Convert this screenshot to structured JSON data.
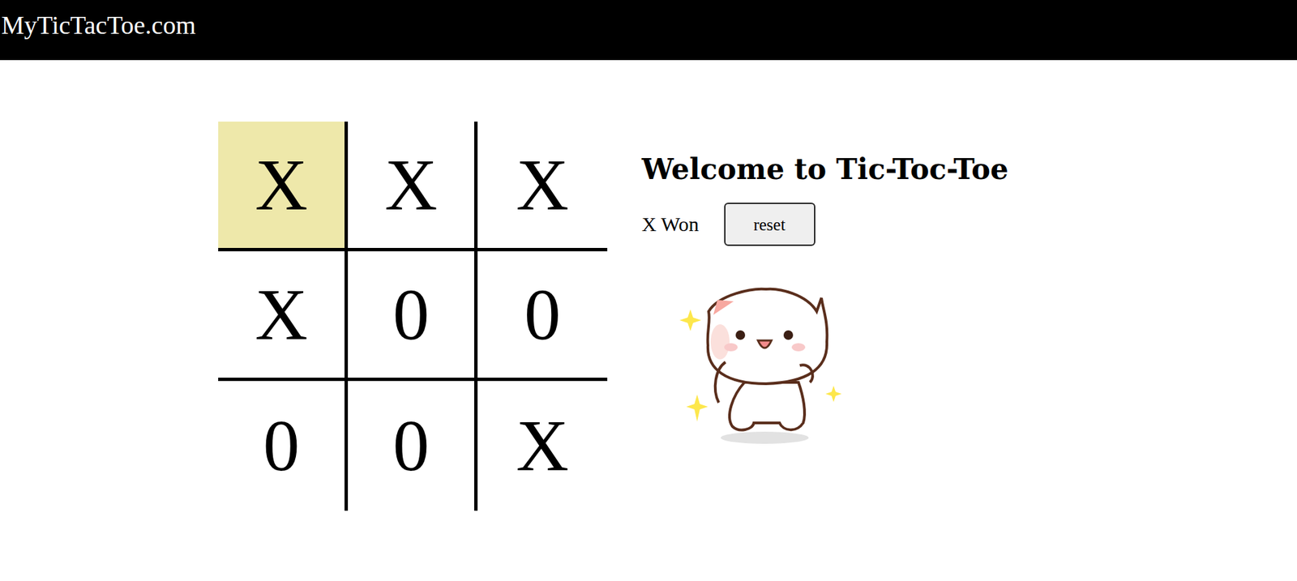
{
  "header": {
    "title": "MyTicTacToe.com"
  },
  "board": {
    "cells": [
      {
        "text": "X",
        "highlighted": true
      },
      {
        "text": "X",
        "highlighted": false
      },
      {
        "text": "X",
        "highlighted": false
      },
      {
        "text": "X",
        "highlighted": false
      },
      {
        "text": "0",
        "highlighted": false
      },
      {
        "text": "0",
        "highlighted": false
      },
      {
        "text": "0",
        "highlighted": false
      },
      {
        "text": "0",
        "highlighted": false
      },
      {
        "text": "X",
        "highlighted": false
      }
    ]
  },
  "panel": {
    "heading": "Welcome to Tic-Toc-Toe",
    "status": "X Won",
    "reset_button": "reset"
  }
}
